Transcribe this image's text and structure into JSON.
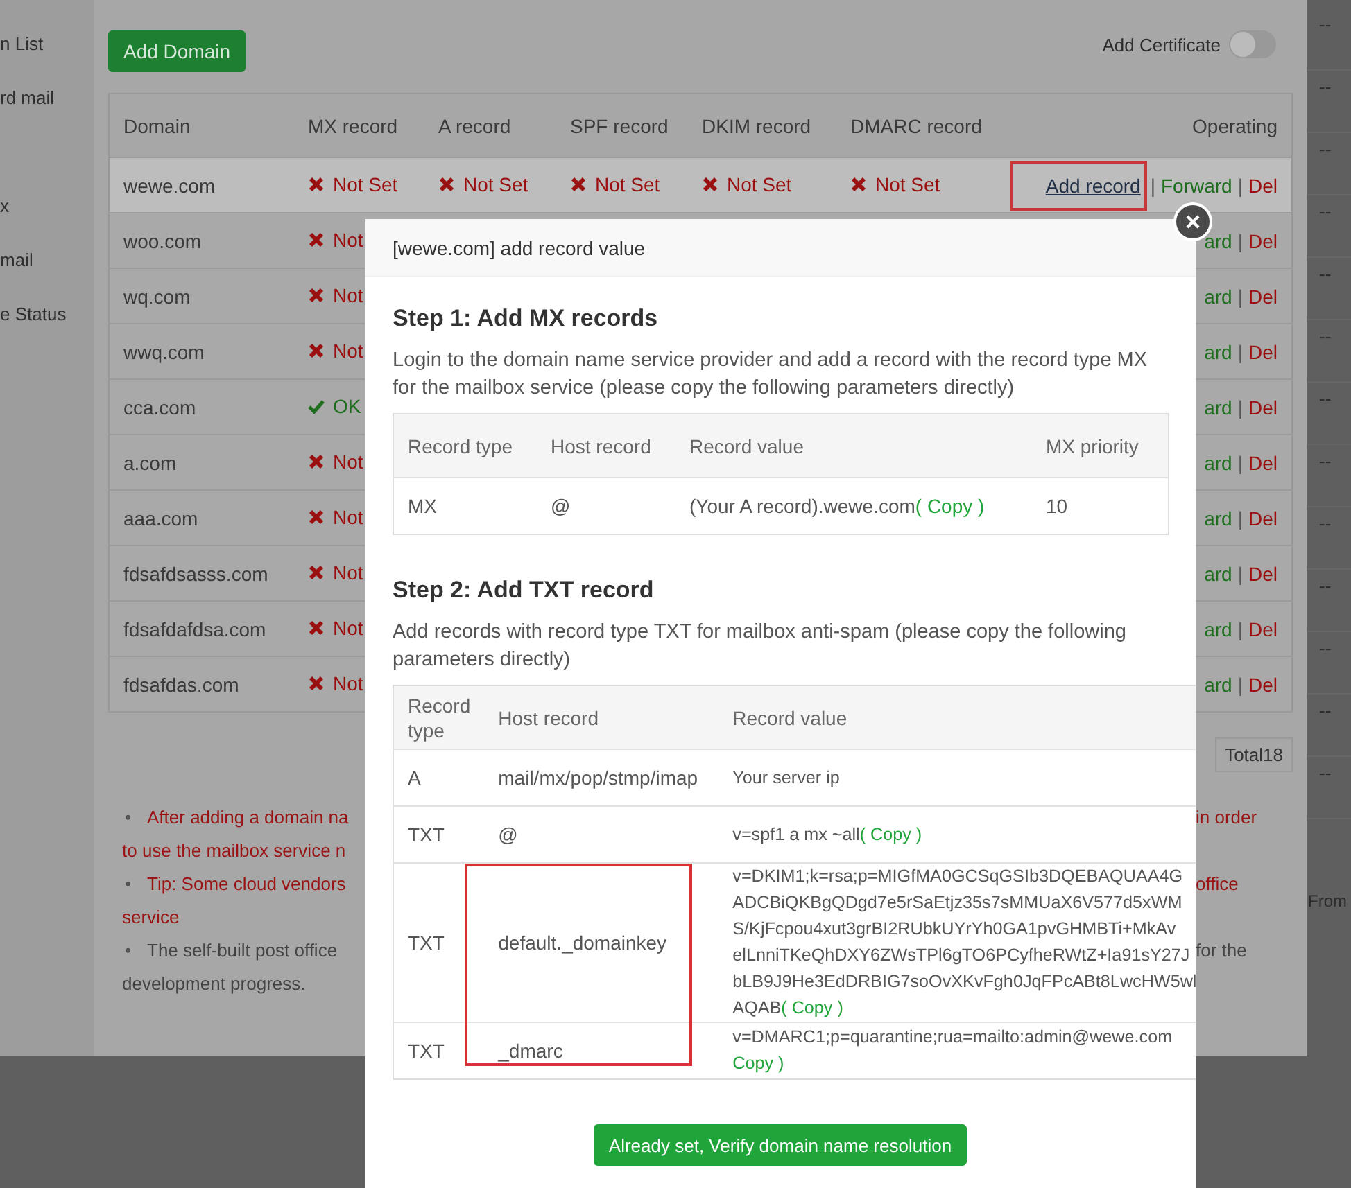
{
  "nav": {
    "items": [
      "n List",
      "rd mail",
      "x",
      "mail",
      "e Status"
    ]
  },
  "toolbar": {
    "add_button": "Add Domain",
    "certificate": {
      "label": "Add Certificate",
      "on": false
    }
  },
  "table": {
    "columns": [
      "Domain",
      "MX record",
      "A record",
      "SPF record",
      "DKIM record",
      "DMARC record",
      "Operating"
    ],
    "rows": [
      {
        "domain": "wewe.com",
        "selected": true,
        "records": [
          {
            "ok": false,
            "text": "Not Set"
          },
          {
            "ok": false,
            "text": "Not Set"
          },
          {
            "ok": false,
            "text": "Not Set"
          },
          {
            "ok": false,
            "text": "Not Set"
          },
          {
            "ok": false,
            "text": "Not Set"
          }
        ],
        "actions": [
          {
            "kind": "link",
            "text": "Add record",
            "highlighted": true
          },
          {
            "kind": "separator",
            "text": "|"
          },
          {
            "kind": "forward",
            "text": "Forward"
          },
          {
            "kind": "separator",
            "text": "|"
          },
          {
            "kind": "delete",
            "text": "Del"
          }
        ]
      },
      {
        "domain": "woo.com",
        "selected": false,
        "records": [
          {
            "ok": false,
            "text": "Not"
          }
        ],
        "actions": [
          {
            "kind": "forward",
            "text": "ard"
          },
          {
            "kind": "separator",
            "text": "|"
          },
          {
            "kind": "delete",
            "text": "Del"
          }
        ]
      },
      {
        "domain": "wq.com",
        "selected": false,
        "records": [
          {
            "ok": false,
            "text": "Not"
          }
        ],
        "actions": [
          {
            "kind": "forward",
            "text": "ard"
          },
          {
            "kind": "separator",
            "text": "|"
          },
          {
            "kind": "delete",
            "text": "Del"
          }
        ]
      },
      {
        "domain": "wwq.com",
        "selected": false,
        "records": [
          {
            "ok": false,
            "text": "Not"
          }
        ],
        "actions": [
          {
            "kind": "forward",
            "text": "ard"
          },
          {
            "kind": "separator",
            "text": "|"
          },
          {
            "kind": "delete",
            "text": "Del"
          }
        ]
      },
      {
        "domain": "cca.com",
        "selected": false,
        "records": [
          {
            "ok": true,
            "text": "OK"
          }
        ],
        "actions": [
          {
            "kind": "forward",
            "text": "ard"
          },
          {
            "kind": "separator",
            "text": "|"
          },
          {
            "kind": "delete",
            "text": "Del"
          }
        ]
      },
      {
        "domain": "a.com",
        "selected": false,
        "records": [
          {
            "ok": false,
            "text": "Not"
          }
        ],
        "actions": [
          {
            "kind": "forward",
            "text": "ard"
          },
          {
            "kind": "separator",
            "text": "|"
          },
          {
            "kind": "delete",
            "text": "Del"
          }
        ]
      },
      {
        "domain": "aaa.com",
        "selected": false,
        "records": [
          {
            "ok": false,
            "text": "Not"
          }
        ],
        "actions": [
          {
            "kind": "forward",
            "text": "ard"
          },
          {
            "kind": "separator",
            "text": "|"
          },
          {
            "kind": "delete",
            "text": "Del"
          }
        ]
      },
      {
        "domain": "fdsafdsasss.com",
        "selected": false,
        "records": [
          {
            "ok": false,
            "text": "Not"
          }
        ],
        "actions": [
          {
            "kind": "forward",
            "text": "ard"
          },
          {
            "kind": "separator",
            "text": "|"
          },
          {
            "kind": "delete",
            "text": "Del"
          }
        ]
      },
      {
        "domain": "fdsafdafdsa.com",
        "selected": false,
        "records": [
          {
            "ok": false,
            "text": "Not"
          }
        ],
        "actions": [
          {
            "kind": "forward",
            "text": "ard"
          },
          {
            "kind": "separator",
            "text": "|"
          },
          {
            "kind": "delete",
            "text": "Del"
          }
        ]
      },
      {
        "domain": "fdsafdas.com",
        "selected": false,
        "records": [
          {
            "ok": false,
            "text": "Not"
          }
        ],
        "actions": [
          {
            "kind": "forward",
            "text": "ard"
          },
          {
            "kind": "separator",
            "text": "|"
          },
          {
            "kind": "delete",
            "text": "Del"
          }
        ]
      }
    ]
  },
  "pager": {
    "total": "Total18"
  },
  "notes": [
    {
      "kind": "warning",
      "lines": [
        {
          "bullet": "•",
          "left": "After adding a domain na",
          "right": "in order"
        },
        {
          "left": "to use the mailbox service n"
        }
      ]
    },
    {
      "kind": "warning",
      "lines": [
        {
          "bullet": "•",
          "left": "Tip: Some cloud vendors",
          "right": "office"
        },
        {
          "left": "service"
        }
      ]
    },
    {
      "kind": "info",
      "lines": [
        {
          "bullet": "•",
          "left": "The self-built post office",
          "right": "for the"
        },
        {
          "left": "development progress."
        }
      ]
    }
  ],
  "side_column": {
    "cells": [
      "--",
      "--",
      "--",
      "--",
      "--",
      "--",
      "--",
      "--",
      "--",
      "--",
      "--",
      "--",
      "--",
      "From"
    ]
  },
  "dialog": {
    "title": "[wewe.com] add record value",
    "steps": [
      {
        "heading": "Step 1: Add MX records",
        "description": "Login to the domain name service provider and add a record with the record type MX for the mailbox service (please copy the following parameters directly)",
        "columns": [
          "Record type",
          "Host record",
          "Record value",
          "MX priority"
        ],
        "rows": [
          {
            "cells": [
              {
                "lines": [
                  "MX"
                ]
              },
              {
                "lines": [
                  "@"
                ]
              },
              {
                "lines": [
                  "(Your A record).wewe.com"
                ],
                "copy": "( Copy )"
              },
              {
                "lines": [
                  "10"
                ]
              }
            ]
          }
        ]
      },
      {
        "heading": "Step 2: Add TXT record",
        "description": "Add records with record type TXT for mailbox anti-spam (please copy the following parameters directly)",
        "columns": [
          "Record type",
          "Host record",
          "Record value"
        ],
        "rows": [
          {
            "cells": [
              {
                "lines": [
                  "A"
                ]
              },
              {
                "lines": [
                  "mail/mx/pop/stmp/imap"
                ]
              },
              {
                "lines": [
                  "Your server ip"
                ]
              }
            ]
          },
          {
            "cells": [
              {
                "lines": [
                  "TXT"
                ]
              },
              {
                "lines": [
                  "@"
                ]
              },
              {
                "lines": [
                  "v=spf1 a mx ~all"
                ],
                "copy": "( Copy )"
              }
            ]
          },
          {
            "cells": [
              {
                "lines": [
                  "TXT"
                ]
              },
              {
                "lines": [
                  "default._domainkey"
                ]
              },
              {
                "lines": [
                  "v=DKIM1;k=rsa;p=MIGfMA0GCSqGSIb3DQEBAQUAA4G",
                  "ADCBiQKBgQDgd7e5rSaEtjz35s7sMMUaX6V577d5xWM",
                  "S/KjFcpou4xut3grBI2RUbkUYrYh0GA1pvGHMBTi+MkAv",
                  "elLnniTKeQhDXY6ZWsTPl6gTO6PCyfheRWtZ+Ia91sY27J",
                  "bLB9J9He3EdDRBIG7soOvXKvFgh0JqFPcABt8LwcHW5wl",
                  "AQAB"
                ],
                "copy": "( Copy )"
              }
            ]
          },
          {
            "cells": [
              {
                "lines": [
                  "TXT"
                ]
              },
              {
                "lines": [
                  "_dmarc"
                ]
              },
              {
                "lines": [
                  "v=DMARC1;p=quarantine;rua=mailto:admin@wewe.com"
                ],
                "copy_below": "Copy )"
              }
            ]
          }
        ]
      }
    ],
    "confirm_button": "Already set, Verify domain name resolution"
  }
}
